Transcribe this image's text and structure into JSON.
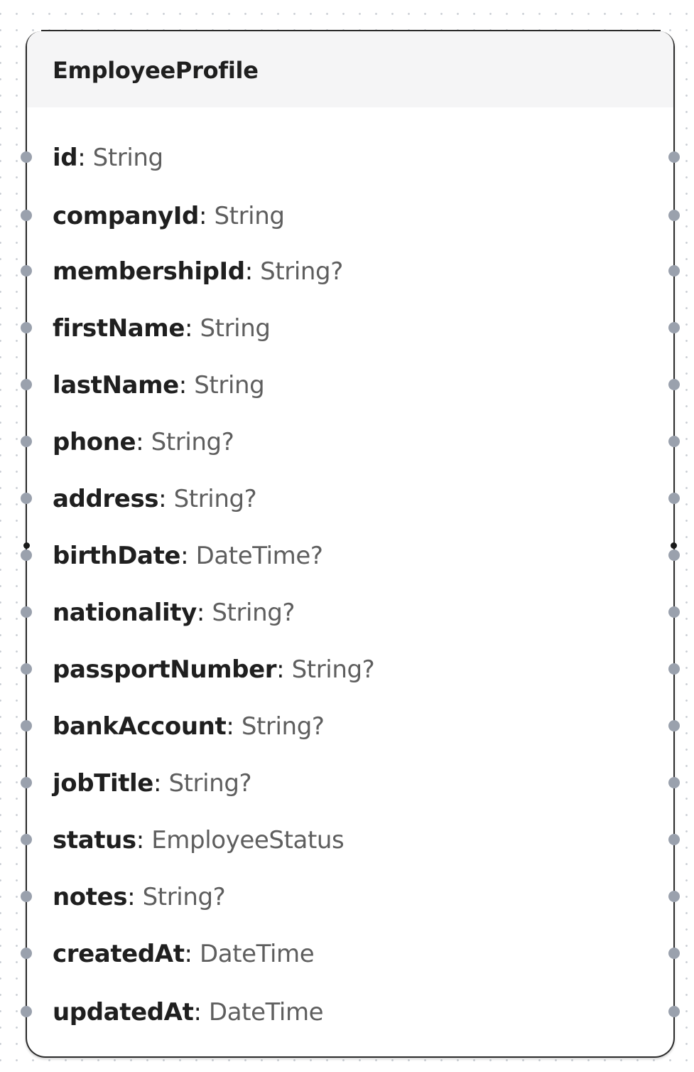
{
  "model": {
    "name": "EmployeeProfile",
    "fields": [
      {
        "name": "id",
        "separator": ": ",
        "type": "String"
      },
      {
        "name": "companyId",
        "separator": ": ",
        "type": "String"
      },
      {
        "name": "membershipId",
        "separator": ": ",
        "type": "String?"
      },
      {
        "name": "firstName",
        "separator": ": ",
        "type": "String"
      },
      {
        "name": "lastName",
        "separator": ": ",
        "type": "String"
      },
      {
        "name": "phone",
        "separator": ": ",
        "type": "String?"
      },
      {
        "name": "address",
        "separator": ": ",
        "type": "String?"
      },
      {
        "name": "birthDate",
        "separator": ": ",
        "type": "DateTime?",
        "connected": true
      },
      {
        "name": "nationality",
        "separator": ": ",
        "type": "String?"
      },
      {
        "name": "passportNumber",
        "separator": ": ",
        "type": "String?"
      },
      {
        "name": "bankAccount",
        "separator": ": ",
        "type": "String?"
      },
      {
        "name": "jobTitle",
        "separator": ": ",
        "type": "String?"
      },
      {
        "name": "status",
        "separator": ": ",
        "type": "EmployeeStatus"
      },
      {
        "name": "notes",
        "separator": ": ",
        "type": "String?"
      },
      {
        "name": "createdAt",
        "separator": ": ",
        "type": "DateTime"
      },
      {
        "name": "updatedAt",
        "separator": ": ",
        "type": "DateTime"
      }
    ]
  },
  "colors": {
    "border": "#2b2b2b",
    "header_bg": "#f5f5f6",
    "handle": "#9aa1ad",
    "field_name": "#1f1f1f",
    "field_type": "#5e5e5e"
  }
}
